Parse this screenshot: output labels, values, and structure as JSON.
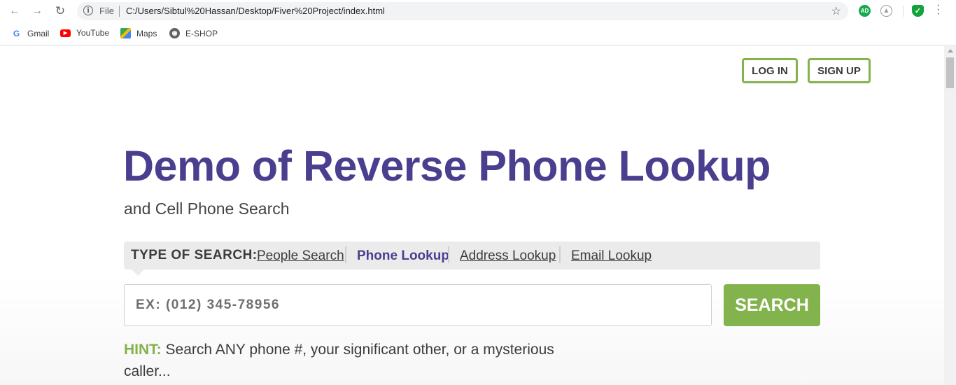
{
  "browser": {
    "file_label": "File",
    "url": "C:/Users/Sibtul%20Hassan/Desktop/Fiver%20Project/index.html",
    "extension_ad_label": "AD",
    "bookmarks": [
      {
        "label": "Gmail",
        "icon": "gmail-icon"
      },
      {
        "label": "YouTube",
        "icon": "youtube-icon"
      },
      {
        "label": "Maps",
        "icon": "maps-icon"
      },
      {
        "label": "E-SHOP",
        "icon": "globe-icon"
      }
    ]
  },
  "header": {
    "login_label": "LOG IN",
    "signup_label": "SIGN UP"
  },
  "hero": {
    "title": "Demo of Reverse Phone Lookup",
    "subtitle": "and Cell Phone Search"
  },
  "search_types": {
    "label": "TYPE OF SEARCH:",
    "options": [
      {
        "label": "People Search",
        "active": false
      },
      {
        "label": "Phone Lookup",
        "active": true
      },
      {
        "label": "Address Lookup",
        "active": false
      },
      {
        "label": "Email Lookup",
        "active": false
      }
    ]
  },
  "search": {
    "placeholder": "EX: (012) 345-78956",
    "value": "",
    "button_label": "SEARCH"
  },
  "hint": {
    "label": "HINT:",
    "text": " Search ANY phone #, your significant other, or a mysterious caller..."
  },
  "colors": {
    "brand_purple": "#4a3f8f",
    "accent_green": "#82b34c"
  }
}
